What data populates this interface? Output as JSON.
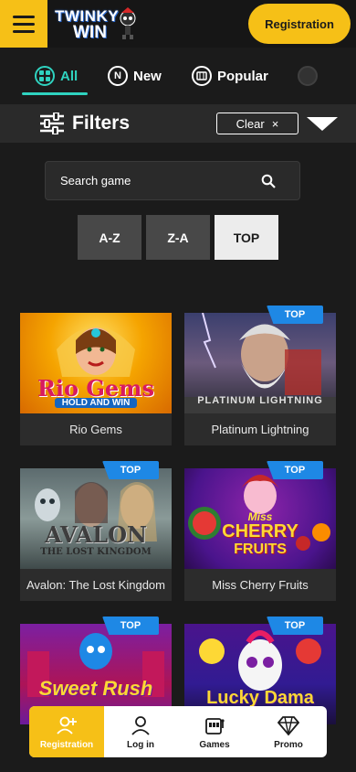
{
  "header": {
    "logo_line1": "TWINKY",
    "logo_line2": "WIN",
    "register_label": "Registration",
    "menu_icon": "hamburger-icon",
    "colors": {
      "accent": "#f6c017",
      "tab_active": "#2fd3c0",
      "badge": "#1e88e5"
    }
  },
  "tabs": [
    {
      "label": "All",
      "icon": "grid-icon",
      "active": true
    },
    {
      "label": "New",
      "icon": "new-icon",
      "active": false
    },
    {
      "label": "Popular",
      "icon": "popular-icon",
      "active": false
    }
  ],
  "filters": {
    "title": "Filters",
    "clear_label": "Clear",
    "clear_icon": "×"
  },
  "search": {
    "placeholder": "Search game"
  },
  "sort": {
    "az": "A-Z",
    "za": "Z-A",
    "top": "TOP",
    "selected": "TOP"
  },
  "games": [
    {
      "title": "Rio Gems",
      "thumb_text": "Rio Gems",
      "thumb_sub": "HOLD AND WIN",
      "badge": ""
    },
    {
      "title": "Platinum Lightning",
      "thumb_text": "PLATINUM LIGHTNING",
      "thumb_sub": "",
      "badge": "TOP"
    },
    {
      "title": "Avalon: The Lost Kingdom",
      "thumb_text": "AVALON",
      "thumb_sub": "THE LOST KINGDOM",
      "badge": "TOP"
    },
    {
      "title": "Miss Cherry Fruits",
      "thumb_text": "CHERRY",
      "thumb_sub": "FRUITS",
      "badge": "TOP"
    },
    {
      "title": "",
      "thumb_text": "Sweet Rush",
      "thumb_sub": "",
      "badge": "TOP"
    },
    {
      "title": "",
      "thumb_text": "Lucky Dama",
      "thumb_sub": "",
      "badge": "TOP"
    }
  ],
  "bottom_nav": [
    {
      "label": "Registration",
      "icon": "add-user-icon",
      "active": true
    },
    {
      "label": "Log in",
      "icon": "user-icon",
      "active": false
    },
    {
      "label": "Games",
      "icon": "slot-machine-icon",
      "active": false
    },
    {
      "label": "Promo",
      "icon": "diamond-icon",
      "active": false
    }
  ]
}
